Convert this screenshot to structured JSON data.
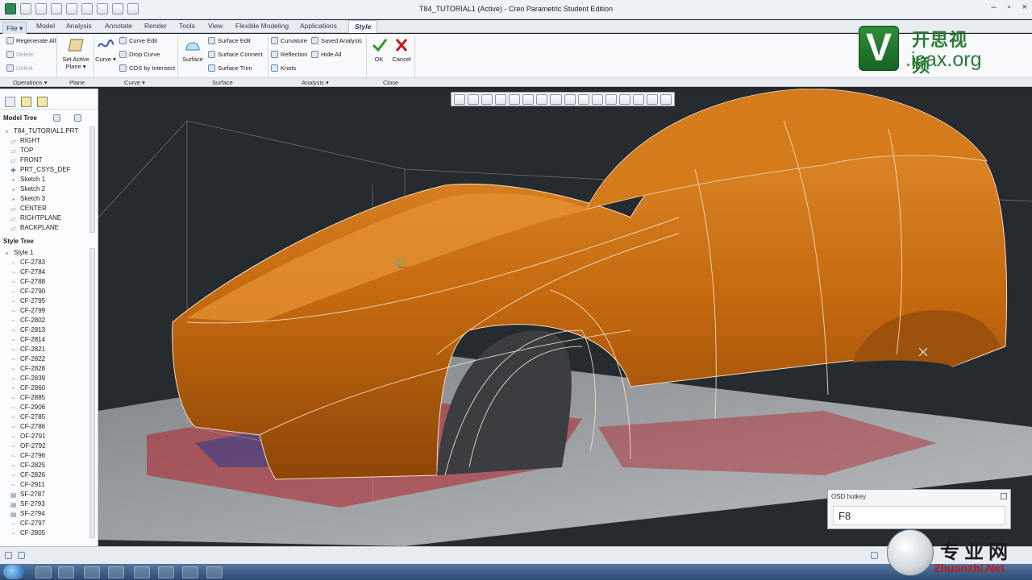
{
  "window": {
    "title": "T84_TUTORIAL1 (Active) - Creo Parametric Student Edition",
    "controls": [
      "–",
      "▫",
      "×"
    ]
  },
  "menu_tabs": [
    "File ▾",
    "Model",
    "Analysis",
    "Annotate",
    "Render",
    "Tools",
    "View",
    "Flexible Modeling",
    "Applications",
    "Style"
  ],
  "ribbon": {
    "operations": {
      "regenerate": "Regenerate All",
      "delete": "Delete",
      "unlink": "Unlink"
    },
    "plane": {
      "set_active": "Set Active Plane ▾"
    },
    "curve": {
      "curve": "Curve ▾",
      "curve_edit": "Curve Edit",
      "drop_curve": "Drop Curve",
      "cos": "COS by Intersect"
    },
    "surface": {
      "surface": "Surface",
      "surface_edit": "Surface Edit",
      "surface_connect": "Surface Connect",
      "surface_trim": "Surface Trim"
    },
    "analysis": {
      "curvature": "Curvature",
      "reflection": "Reflection",
      "knots": "Knots",
      "saved_analysis": "Saved Analysis",
      "hide_all": "Hide All"
    },
    "close": {
      "ok": "OK",
      "cancel": "Cancel"
    }
  },
  "ribbon_groups": [
    "Operations ▾",
    "Plane",
    "Curve ▾",
    "Surface",
    "Analysis ▾",
    "Close"
  ],
  "watermark_top": {
    "letter": "V",
    "cn": "开思视频",
    "url": ".icax.org"
  },
  "model_tree": {
    "header": "Model Tree",
    "items": [
      "T84_TUTORIAL1.PRT",
      "RIGHT",
      "TOP",
      "FRONT",
      "PRT_CSYS_DEF",
      "Sketch 1",
      "Sketch 2",
      "Sketch 3",
      "CENTER",
      "RIGHTPLANE",
      "BACKPLANE"
    ]
  },
  "style_tree": {
    "header": "Style Tree",
    "items": [
      "Style 1",
      "CF-2783",
      "CF-2784",
      "CF-2788",
      "CF-2790",
      "CF-2795",
      "CF-2799",
      "CF-2802",
      "CF-2813",
      "CF-2814",
      "CF-2821",
      "CF-2822",
      "CF-2828",
      "CF-2839",
      "CF-2860",
      "CF-2885",
      "CF-2906",
      "CF-2785",
      "CF-2786",
      "OF-2791",
      "OF-2792",
      "CF-2796",
      "CF-2825",
      "CF-2826",
      "CF-2911",
      "SF-2787",
      "SF-2793",
      "SF-2794",
      "CF-2797",
      "CF-2805"
    ]
  },
  "osd": {
    "title": "OSD hotkey",
    "value": "F8"
  },
  "watermark_bottom": {
    "cn": "专业网",
    "url": "Zhuanzhi.Net"
  },
  "colors": {
    "body_orange": "#c5690f",
    "accent_green": "#2b7a36",
    "ok_green": "#2a9a2a",
    "cancel_red": "#c21a1a"
  }
}
